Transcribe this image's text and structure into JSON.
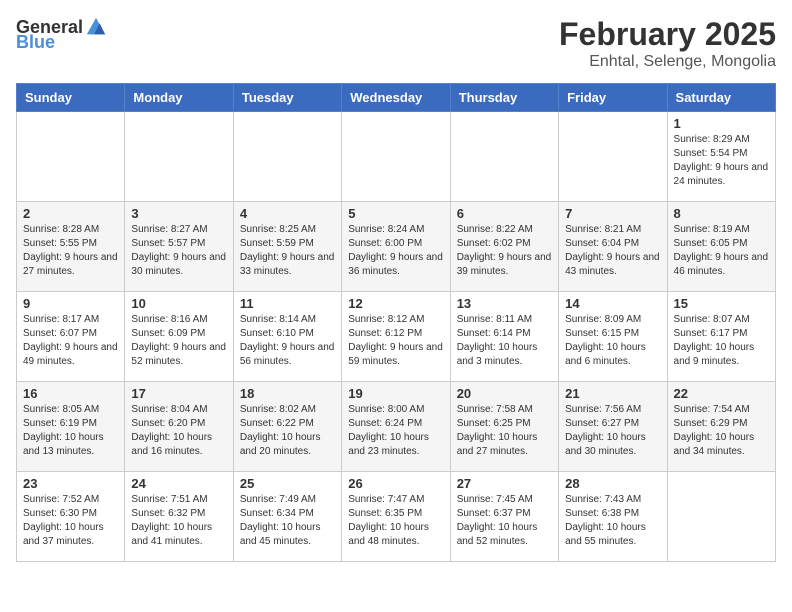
{
  "header": {
    "logo": {
      "text_general": "General",
      "text_blue": "Blue"
    },
    "title": "February 2025",
    "subtitle": "Enhtal, Selenge, Mongolia"
  },
  "calendar": {
    "days_of_week": [
      "Sunday",
      "Monday",
      "Tuesday",
      "Wednesday",
      "Thursday",
      "Friday",
      "Saturday"
    ],
    "weeks": [
      [
        {
          "day": "",
          "info": ""
        },
        {
          "day": "",
          "info": ""
        },
        {
          "day": "",
          "info": ""
        },
        {
          "day": "",
          "info": ""
        },
        {
          "day": "",
          "info": ""
        },
        {
          "day": "",
          "info": ""
        },
        {
          "day": "1",
          "info": "Sunrise: 8:29 AM\nSunset: 5:54 PM\nDaylight: 9 hours and 24 minutes."
        }
      ],
      [
        {
          "day": "2",
          "info": "Sunrise: 8:28 AM\nSunset: 5:55 PM\nDaylight: 9 hours and 27 minutes."
        },
        {
          "day": "3",
          "info": "Sunrise: 8:27 AM\nSunset: 5:57 PM\nDaylight: 9 hours and 30 minutes."
        },
        {
          "day": "4",
          "info": "Sunrise: 8:25 AM\nSunset: 5:59 PM\nDaylight: 9 hours and 33 minutes."
        },
        {
          "day": "5",
          "info": "Sunrise: 8:24 AM\nSunset: 6:00 PM\nDaylight: 9 hours and 36 minutes."
        },
        {
          "day": "6",
          "info": "Sunrise: 8:22 AM\nSunset: 6:02 PM\nDaylight: 9 hours and 39 minutes."
        },
        {
          "day": "7",
          "info": "Sunrise: 8:21 AM\nSunset: 6:04 PM\nDaylight: 9 hours and 43 minutes."
        },
        {
          "day": "8",
          "info": "Sunrise: 8:19 AM\nSunset: 6:05 PM\nDaylight: 9 hours and 46 minutes."
        }
      ],
      [
        {
          "day": "9",
          "info": "Sunrise: 8:17 AM\nSunset: 6:07 PM\nDaylight: 9 hours and 49 minutes."
        },
        {
          "day": "10",
          "info": "Sunrise: 8:16 AM\nSunset: 6:09 PM\nDaylight: 9 hours and 52 minutes."
        },
        {
          "day": "11",
          "info": "Sunrise: 8:14 AM\nSunset: 6:10 PM\nDaylight: 9 hours and 56 minutes."
        },
        {
          "day": "12",
          "info": "Sunrise: 8:12 AM\nSunset: 6:12 PM\nDaylight: 9 hours and 59 minutes."
        },
        {
          "day": "13",
          "info": "Sunrise: 8:11 AM\nSunset: 6:14 PM\nDaylight: 10 hours and 3 minutes."
        },
        {
          "day": "14",
          "info": "Sunrise: 8:09 AM\nSunset: 6:15 PM\nDaylight: 10 hours and 6 minutes."
        },
        {
          "day": "15",
          "info": "Sunrise: 8:07 AM\nSunset: 6:17 PM\nDaylight: 10 hours and 9 minutes."
        }
      ],
      [
        {
          "day": "16",
          "info": "Sunrise: 8:05 AM\nSunset: 6:19 PM\nDaylight: 10 hours and 13 minutes."
        },
        {
          "day": "17",
          "info": "Sunrise: 8:04 AM\nSunset: 6:20 PM\nDaylight: 10 hours and 16 minutes."
        },
        {
          "day": "18",
          "info": "Sunrise: 8:02 AM\nSunset: 6:22 PM\nDaylight: 10 hours and 20 minutes."
        },
        {
          "day": "19",
          "info": "Sunrise: 8:00 AM\nSunset: 6:24 PM\nDaylight: 10 hours and 23 minutes."
        },
        {
          "day": "20",
          "info": "Sunrise: 7:58 AM\nSunset: 6:25 PM\nDaylight: 10 hours and 27 minutes."
        },
        {
          "day": "21",
          "info": "Sunrise: 7:56 AM\nSunset: 6:27 PM\nDaylight: 10 hours and 30 minutes."
        },
        {
          "day": "22",
          "info": "Sunrise: 7:54 AM\nSunset: 6:29 PM\nDaylight: 10 hours and 34 minutes."
        }
      ],
      [
        {
          "day": "23",
          "info": "Sunrise: 7:52 AM\nSunset: 6:30 PM\nDaylight: 10 hours and 37 minutes."
        },
        {
          "day": "24",
          "info": "Sunrise: 7:51 AM\nSunset: 6:32 PM\nDaylight: 10 hours and 41 minutes."
        },
        {
          "day": "25",
          "info": "Sunrise: 7:49 AM\nSunset: 6:34 PM\nDaylight: 10 hours and 45 minutes."
        },
        {
          "day": "26",
          "info": "Sunrise: 7:47 AM\nSunset: 6:35 PM\nDaylight: 10 hours and 48 minutes."
        },
        {
          "day": "27",
          "info": "Sunrise: 7:45 AM\nSunset: 6:37 PM\nDaylight: 10 hours and 52 minutes."
        },
        {
          "day": "28",
          "info": "Sunrise: 7:43 AM\nSunset: 6:38 PM\nDaylight: 10 hours and 55 minutes."
        },
        {
          "day": "",
          "info": ""
        }
      ]
    ]
  }
}
